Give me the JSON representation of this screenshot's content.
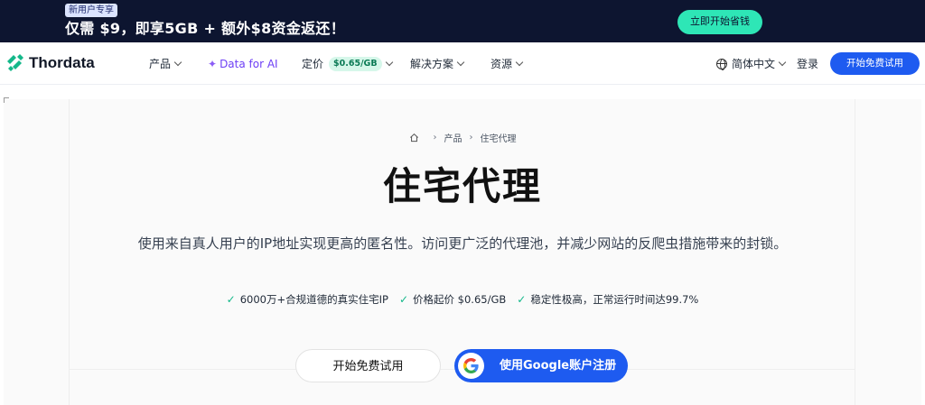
{
  "promo": {
    "badge": "新用户专享",
    "headline": "仅需 $9，即享5GB + 额外$8资金返还！",
    "cta": "立即开始省钱"
  },
  "nav": {
    "brand": "Thordata",
    "products": "产品",
    "data_for_ai": "Data for AI",
    "pricing": "定价",
    "pricing_badge": "$0.65/GB",
    "solutions": "解决方案",
    "resources": "资源",
    "language": "简体中文",
    "login": "登录",
    "cta": "开始免费试用"
  },
  "breadcrumb": {
    "items": [
      "产品",
      "住宅代理"
    ]
  },
  "hero": {
    "title": "住宅代理",
    "description": "使用来自真人用户的IP地址实现更高的匿名性。访问更广泛的代理池，并减少网站的反爬虫措施带来的封锁。",
    "features": [
      "6000万+合规道德的真实住宅IP",
      "价格起价 $0.65/GB",
      "稳定性极高，正常运行时间达99.7%"
    ],
    "trial_button": "开始免费试用",
    "google_button": "使用Google账户注册"
  },
  "colors": {
    "promo_bg": "#0d1530",
    "accent_green": "#2ee6b6",
    "primary_blue": "#1e5bf0",
    "ai_purple": "#6d3ff5",
    "check_green": "#14b88a"
  },
  "icons": {
    "logo": "thordata-logo-icon",
    "sparkle": "sparkle-icon",
    "globe": "globe-icon",
    "home": "home-icon",
    "check": "check-icon",
    "google": "google-icon"
  }
}
